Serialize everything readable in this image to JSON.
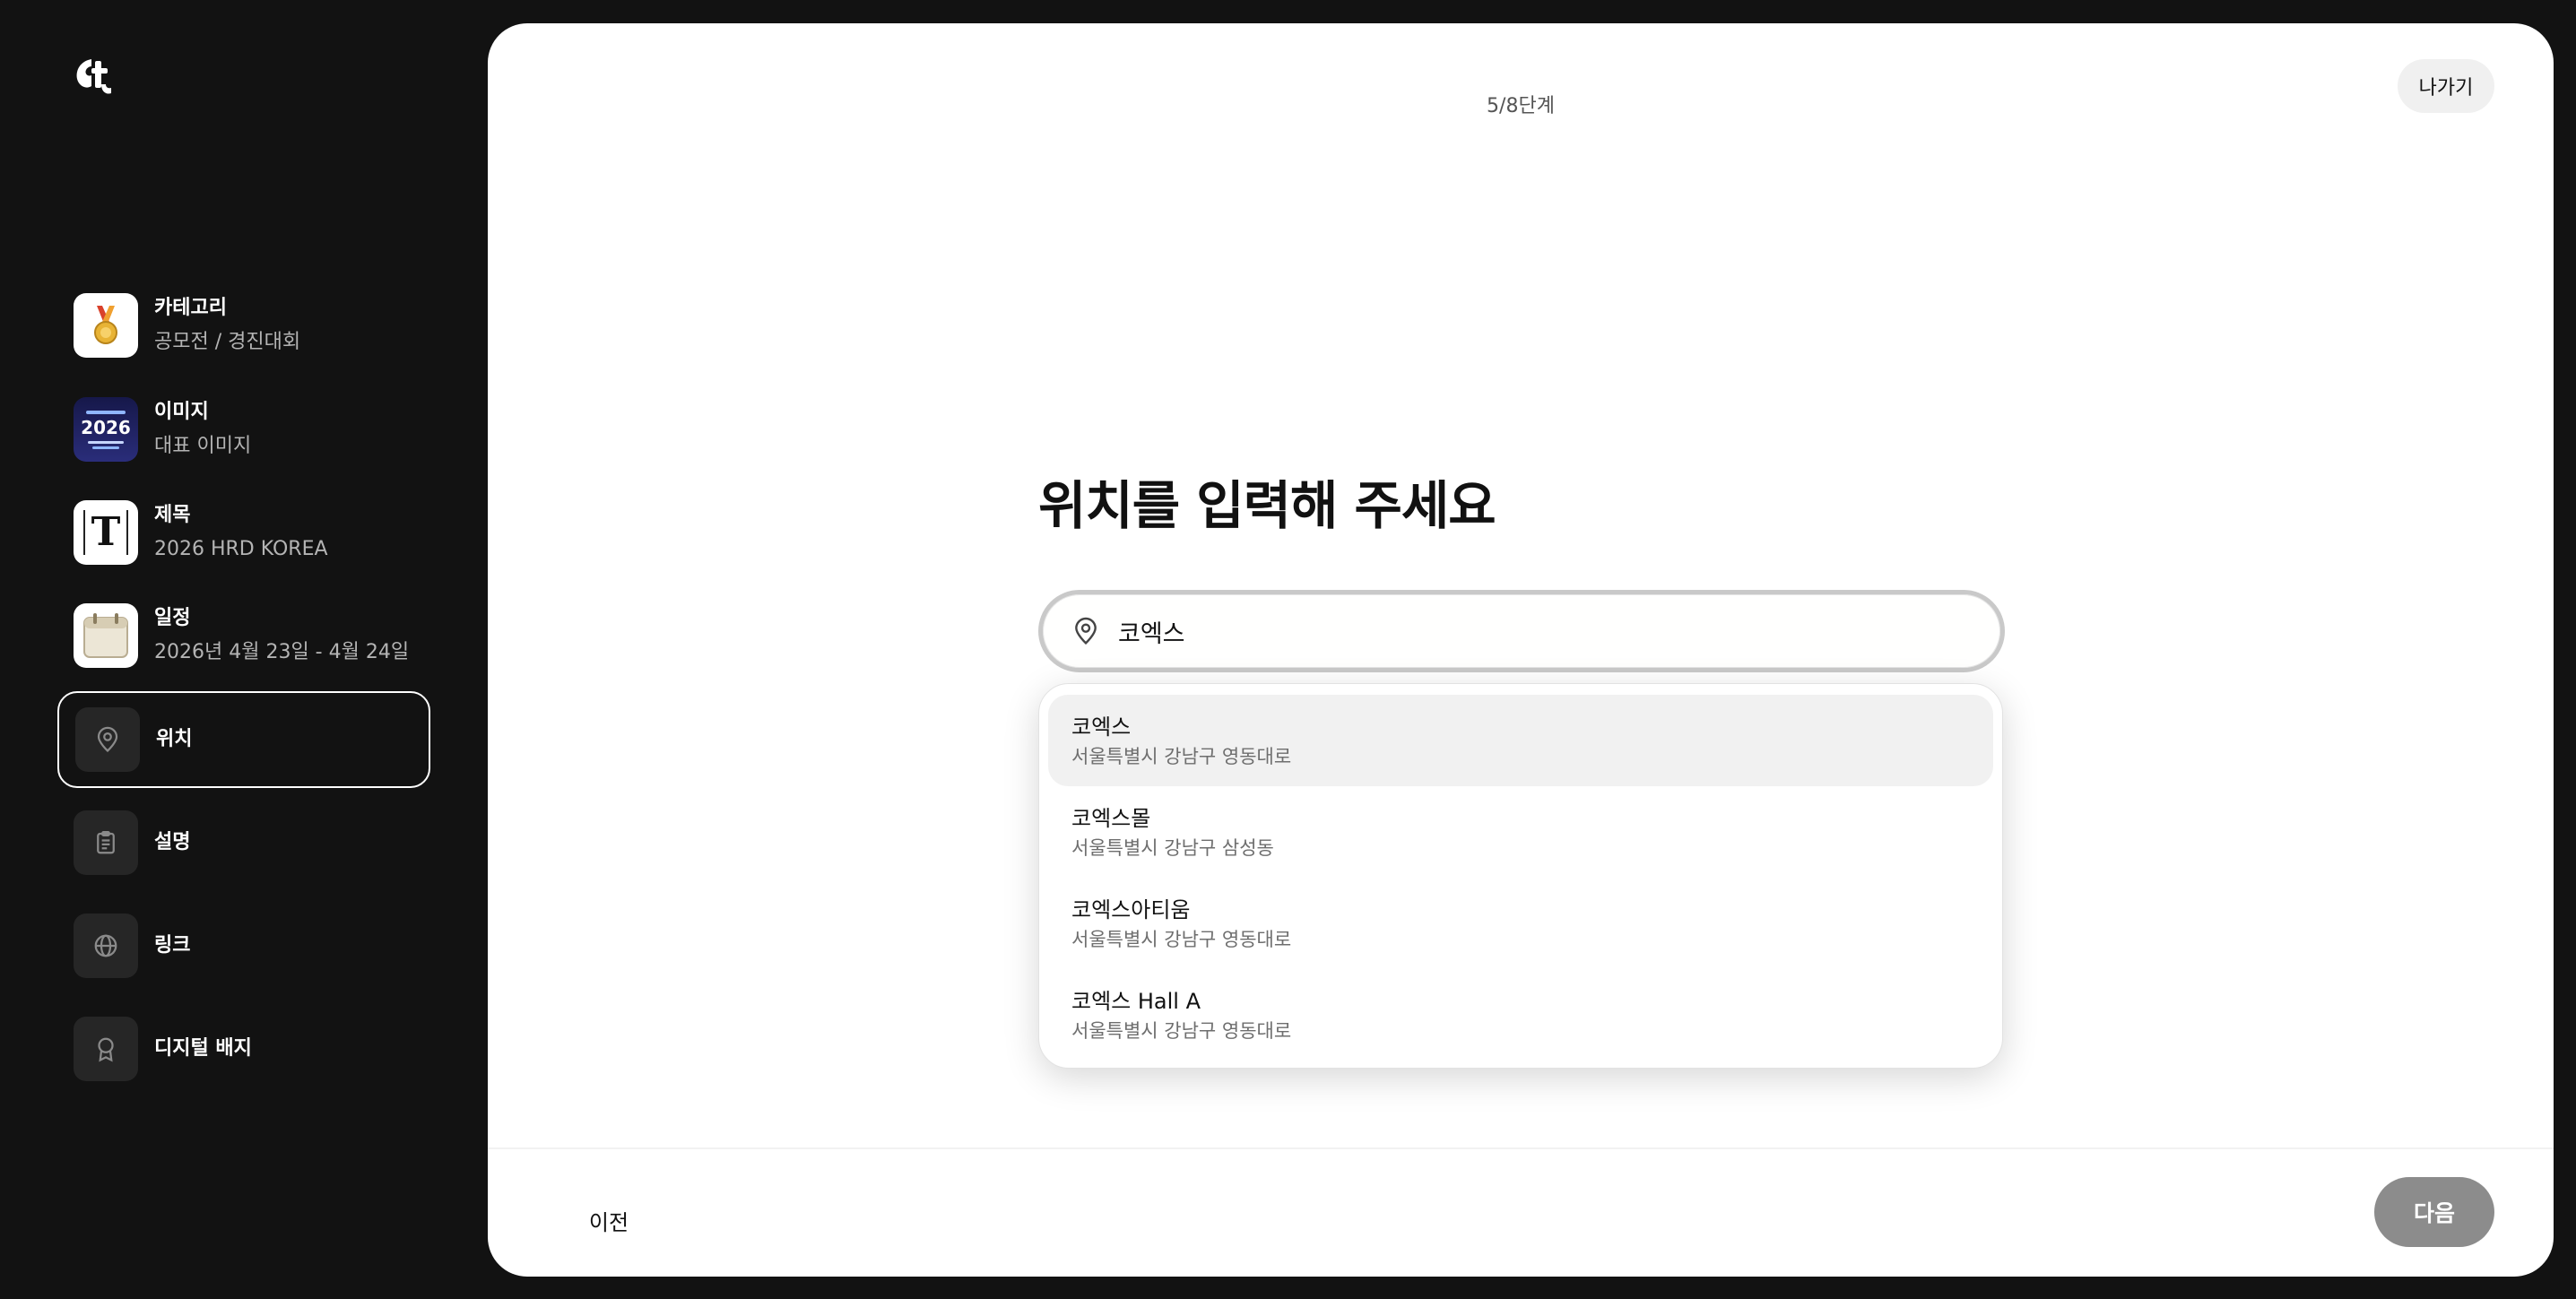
{
  "progress": {
    "step_text": "5/8단계"
  },
  "header": {
    "exit_label": "나가기"
  },
  "sidebar": {
    "items": [
      {
        "label": "카테고리",
        "value": "공모전 / 경진대회",
        "icon": "medal-icon"
      },
      {
        "label": "이미지",
        "value": "대표 이미지",
        "icon": "event-poster-thumbnail",
        "thumb_text": "2026"
      },
      {
        "label": "제목",
        "value": "2026 HRD KOREA",
        "icon": "title-t-icon",
        "thumb_text": "T"
      },
      {
        "label": "일정",
        "value": "2026년 4월 23일 - 4월 24일",
        "icon": "calendar-icon"
      },
      {
        "label": "위치",
        "value": "",
        "icon": "location-pin-icon",
        "active": true
      },
      {
        "label": "설명",
        "value": "",
        "icon": "clipboard-icon"
      },
      {
        "label": "링크",
        "value": "",
        "icon": "globe-icon"
      },
      {
        "label": "디지털 배지",
        "value": "",
        "icon": "badge-icon"
      }
    ]
  },
  "main": {
    "heading": "위치를 입력해 주세요",
    "search": {
      "value": "코엑스",
      "icon": "location-pin-icon"
    },
    "results": [
      {
        "name": "코엑스",
        "address": "서울특별시 강남구 영동대로"
      },
      {
        "name": "코엑스몰",
        "address": "서울특별시 강남구 삼성동"
      },
      {
        "name": "코엑스아티움",
        "address": "서울특별시 강남구 영동대로"
      },
      {
        "name": "코엑스 Hall A",
        "address": "서울특별시 강남구 영동대로"
      }
    ]
  },
  "footer": {
    "prev_label": "이전",
    "next_label": "다음"
  },
  "colors": {
    "background": "#121212",
    "panel": "#ffffff",
    "next_button": "#8c8c8c",
    "highlight_row": "#f1f1f1"
  }
}
